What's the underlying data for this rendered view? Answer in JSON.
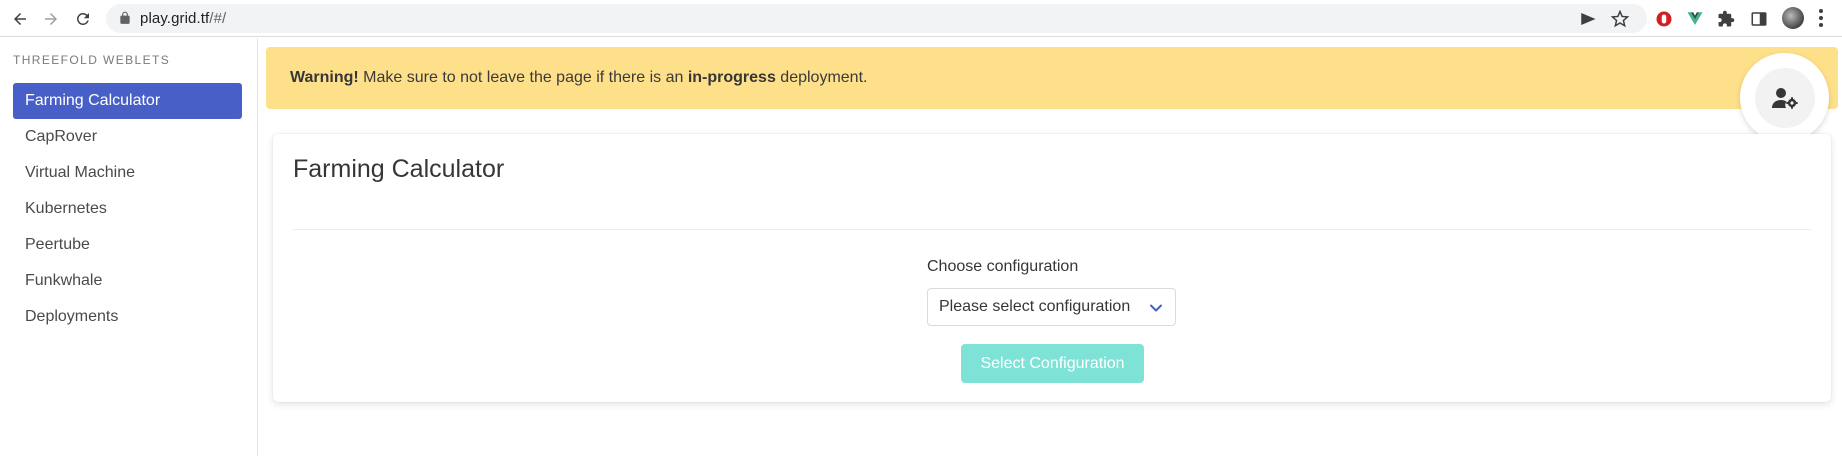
{
  "browser": {
    "url_host": "play.grid.tf",
    "url_path": "/#/"
  },
  "icons": {
    "back": "arrow-left-icon",
    "forward": "arrow-right-icon",
    "reload": "reload-icon",
    "lock": "lock-icon",
    "send": "send-icon",
    "bookmark": "star-icon",
    "ext1": "shield-extension-icon",
    "ext2": "vue-extension-icon",
    "ext3": "puzzle-icon",
    "sidepanel": "side-panel-icon",
    "profile": "user-cog-icon"
  },
  "colors": {
    "accent": "#485fc7",
    "warning_bg": "#ffe08a",
    "button_disabled": "#7ee3d6"
  },
  "sidebar": {
    "title": "THREEFOLD WEBLETS",
    "items": [
      {
        "label": "Farming Calculator",
        "active": true
      },
      {
        "label": "CapRover"
      },
      {
        "label": "Virtual Machine"
      },
      {
        "label": "Kubernetes"
      },
      {
        "label": "Peertube"
      },
      {
        "label": "Funkwhale"
      },
      {
        "label": "Deployments"
      }
    ]
  },
  "warning": {
    "strong": "Warning!",
    "text_before": " Make sure to not leave the page if there is an ",
    "strong2": "in-progress",
    "text_after": " deployment."
  },
  "card": {
    "title": "Farming Calculator",
    "field_label": "Choose configuration",
    "select_value": "Please select configuration",
    "button_label": "Select Configuration"
  }
}
